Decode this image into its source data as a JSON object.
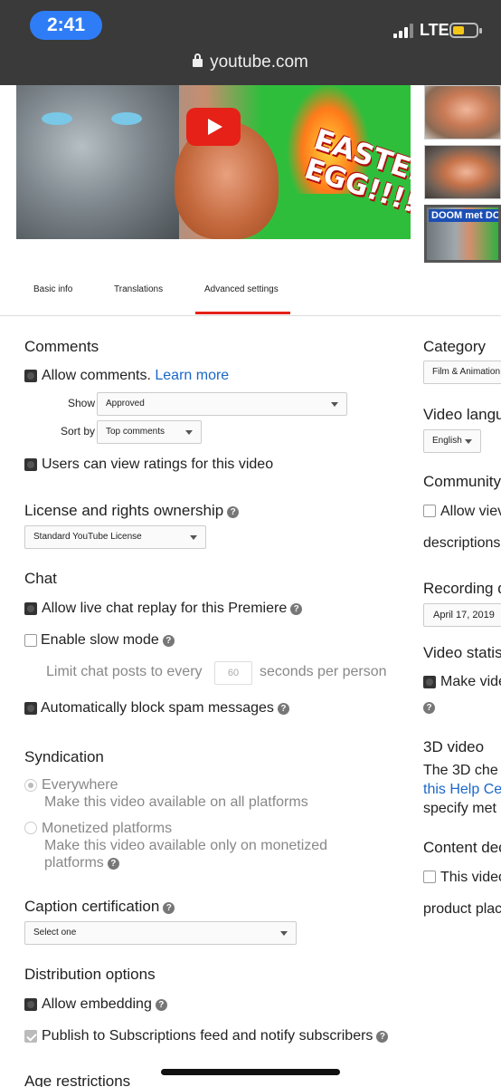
{
  "status": {
    "time": "2:41",
    "network": "LTE",
    "url": "youtube.com"
  },
  "thumbnail": {
    "overlay_text": "EASTER\nEGG!!!!",
    "side_caption": "DOOM met DO"
  },
  "tabs": [
    {
      "label": "Basic info"
    },
    {
      "label": "Translations"
    },
    {
      "label": "Advanced settings",
      "active": true
    }
  ],
  "comments": {
    "heading": "Comments",
    "allow_label": "Allow comments.",
    "learn_more": "Learn more",
    "show_label": "Show",
    "show_value": "Approved",
    "sort_label": "Sort by",
    "sort_value": "Top comments",
    "ratings_label": "Users can view ratings for this video"
  },
  "license": {
    "heading": "License and rights ownership",
    "value": "Standard YouTube License"
  },
  "chat": {
    "heading": "Chat",
    "replay_label": "Allow live chat replay for this Premiere",
    "slow_mode_label": "Enable slow mode",
    "limit_label": "Limit chat posts to every",
    "limit_value": "60",
    "limit_suffix": "seconds per person",
    "spam_label": "Automatically block spam messages"
  },
  "syndication": {
    "heading": "Syndication",
    "everywhere_label": "Everywhere",
    "everywhere_desc": "Make this video available on all platforms",
    "monetized_label": "Monetized platforms",
    "monetized_desc_1": "Make this video available only on monetized",
    "monetized_desc_2": "platforms"
  },
  "caption": {
    "heading": "Caption certification",
    "value": "Select one"
  },
  "distribution": {
    "heading": "Distribution options",
    "embed_label": "Allow embedding",
    "publish_label": "Publish to Subscriptions feed and notify subscribers"
  },
  "age": {
    "heading": "Age restrictions"
  },
  "right": {
    "category_heading": "Category",
    "category_value": "Film & Animation",
    "language_heading": "Video langu",
    "language_value": "English",
    "community_heading": "Community",
    "community_allow": "Allow viev",
    "community_desc": "descriptions",
    "recording_heading": "Recording d",
    "recording_value": "April 17, 2019",
    "stats_heading": "Video statis",
    "stats_make": "Make vide",
    "threed_heading": "3D video",
    "threed_line1": "The 3D che",
    "threed_line2": "this Help Ce",
    "threed_line3": "specify met",
    "content_heading": "Content dec",
    "content_label": "This video",
    "content_line2": "product plac"
  }
}
